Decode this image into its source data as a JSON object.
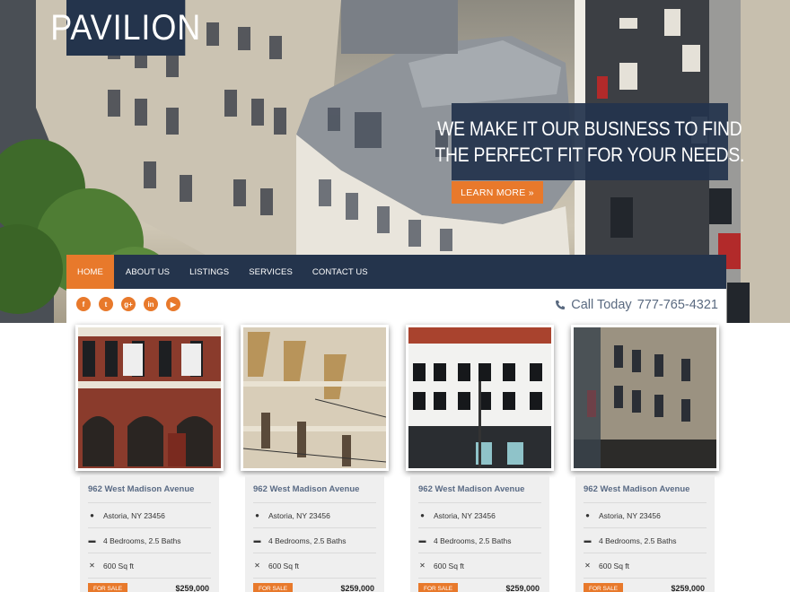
{
  "brand": {
    "logo_text": "PAVILION"
  },
  "hero": {
    "headline_line1": "WE MAKE IT OUR BUSINESS TO FIND",
    "headline_line2": "THE PERFECT FIT FOR YOUR NEEDS.",
    "cta_label": "LEARN MORE »"
  },
  "nav": {
    "items": [
      {
        "label": "HOME",
        "active": true
      },
      {
        "label": "ABOUT US",
        "active": false
      },
      {
        "label": "LISTINGS",
        "active": false
      },
      {
        "label": "SERVICES",
        "active": false
      },
      {
        "label": "CONTACT US",
        "active": false
      }
    ]
  },
  "social": {
    "icons": [
      {
        "name": "facebook-icon",
        "glyph": "f"
      },
      {
        "name": "twitter-icon",
        "glyph": "t"
      },
      {
        "name": "google-plus-icon",
        "glyph": "g+"
      },
      {
        "name": "linkedin-icon",
        "glyph": "in"
      },
      {
        "name": "youtube-icon",
        "glyph": "▶"
      }
    ]
  },
  "contact": {
    "call_label": "Call Today",
    "phone": "777-765-4321"
  },
  "listings": [
    {
      "title": "962 West Madison Avenue",
      "location": "Astoria, NY 23456",
      "rooms": "4 Bedrooms, 2.5 Baths",
      "area": "600 Sq ft",
      "badge": "FOR SALE",
      "price": "$259,000"
    },
    {
      "title": "962 West Madison Avenue",
      "location": "Astoria, NY 23456",
      "rooms": "4 Bedrooms, 2.5 Baths",
      "area": "600 Sq ft",
      "badge": "FOR SALE",
      "price": "$259,000"
    },
    {
      "title": "962 West Madison Avenue",
      "location": "Astoria, NY 23456",
      "rooms": "4 Bedrooms, 2.5 Baths",
      "area": "600 Sq ft",
      "badge": "FOR SALE",
      "price": "$259,000"
    },
    {
      "title": "962 West Madison Avenue",
      "location": "Astoria, NY 23456",
      "rooms": "4 Bedrooms, 2.5 Baths",
      "area": "600 Sq ft",
      "badge": "FOR SALE",
      "price": "$259,000"
    }
  ],
  "colors": {
    "navy": "#24344c",
    "accent": "#e8792b",
    "muted_blue": "#5a6b85"
  }
}
